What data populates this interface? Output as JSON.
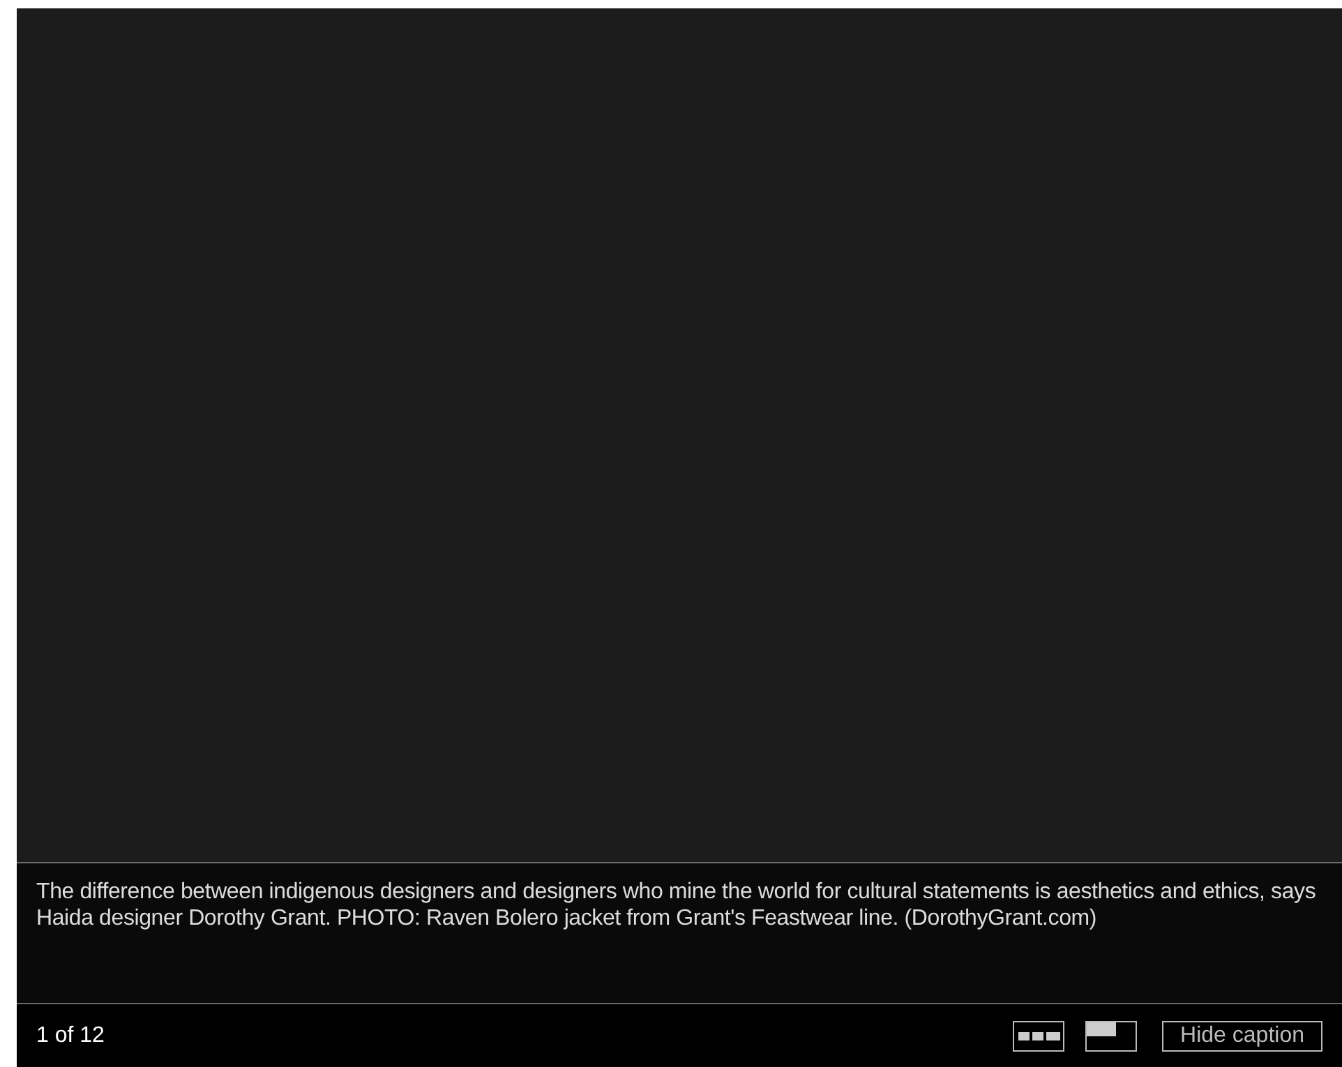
{
  "caption": "The difference between indigenous designers and designers who mine the world for cultural statements is aesthetics and ethics, says Haida designer Dorothy Grant. PHOTO: Raven Bolero jacket from Grant's Feastwear line. (DorothyGrant.com)",
  "counter": "1 of 12",
  "caption_button": "Hide caption"
}
